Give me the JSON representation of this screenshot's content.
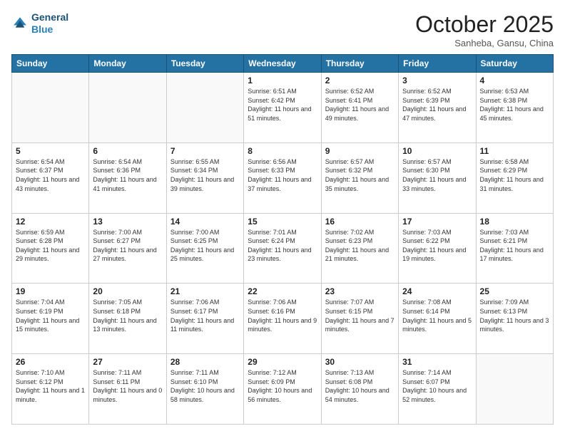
{
  "header": {
    "logo_line1": "General",
    "logo_line2": "Blue",
    "month_title": "October 2025",
    "location": "Sanheba, Gansu, China"
  },
  "weekdays": [
    "Sunday",
    "Monday",
    "Tuesday",
    "Wednesday",
    "Thursday",
    "Friday",
    "Saturday"
  ],
  "weeks": [
    [
      {
        "day": "",
        "sunrise": "",
        "sunset": "",
        "daylight": ""
      },
      {
        "day": "",
        "sunrise": "",
        "sunset": "",
        "daylight": ""
      },
      {
        "day": "",
        "sunrise": "",
        "sunset": "",
        "daylight": ""
      },
      {
        "day": "1",
        "sunrise": "Sunrise: 6:51 AM",
        "sunset": "Sunset: 6:42 PM",
        "daylight": "Daylight: 11 hours and 51 minutes."
      },
      {
        "day": "2",
        "sunrise": "Sunrise: 6:52 AM",
        "sunset": "Sunset: 6:41 PM",
        "daylight": "Daylight: 11 hours and 49 minutes."
      },
      {
        "day": "3",
        "sunrise": "Sunrise: 6:52 AM",
        "sunset": "Sunset: 6:39 PM",
        "daylight": "Daylight: 11 hours and 47 minutes."
      },
      {
        "day": "4",
        "sunrise": "Sunrise: 6:53 AM",
        "sunset": "Sunset: 6:38 PM",
        "daylight": "Daylight: 11 hours and 45 minutes."
      }
    ],
    [
      {
        "day": "5",
        "sunrise": "Sunrise: 6:54 AM",
        "sunset": "Sunset: 6:37 PM",
        "daylight": "Daylight: 11 hours and 43 minutes."
      },
      {
        "day": "6",
        "sunrise": "Sunrise: 6:54 AM",
        "sunset": "Sunset: 6:36 PM",
        "daylight": "Daylight: 11 hours and 41 minutes."
      },
      {
        "day": "7",
        "sunrise": "Sunrise: 6:55 AM",
        "sunset": "Sunset: 6:34 PM",
        "daylight": "Daylight: 11 hours and 39 minutes."
      },
      {
        "day": "8",
        "sunrise": "Sunrise: 6:56 AM",
        "sunset": "Sunset: 6:33 PM",
        "daylight": "Daylight: 11 hours and 37 minutes."
      },
      {
        "day": "9",
        "sunrise": "Sunrise: 6:57 AM",
        "sunset": "Sunset: 6:32 PM",
        "daylight": "Daylight: 11 hours and 35 minutes."
      },
      {
        "day": "10",
        "sunrise": "Sunrise: 6:57 AM",
        "sunset": "Sunset: 6:30 PM",
        "daylight": "Daylight: 11 hours and 33 minutes."
      },
      {
        "day": "11",
        "sunrise": "Sunrise: 6:58 AM",
        "sunset": "Sunset: 6:29 PM",
        "daylight": "Daylight: 11 hours and 31 minutes."
      }
    ],
    [
      {
        "day": "12",
        "sunrise": "Sunrise: 6:59 AM",
        "sunset": "Sunset: 6:28 PM",
        "daylight": "Daylight: 11 hours and 29 minutes."
      },
      {
        "day": "13",
        "sunrise": "Sunrise: 7:00 AM",
        "sunset": "Sunset: 6:27 PM",
        "daylight": "Daylight: 11 hours and 27 minutes."
      },
      {
        "day": "14",
        "sunrise": "Sunrise: 7:00 AM",
        "sunset": "Sunset: 6:25 PM",
        "daylight": "Daylight: 11 hours and 25 minutes."
      },
      {
        "day": "15",
        "sunrise": "Sunrise: 7:01 AM",
        "sunset": "Sunset: 6:24 PM",
        "daylight": "Daylight: 11 hours and 23 minutes."
      },
      {
        "day": "16",
        "sunrise": "Sunrise: 7:02 AM",
        "sunset": "Sunset: 6:23 PM",
        "daylight": "Daylight: 11 hours and 21 minutes."
      },
      {
        "day": "17",
        "sunrise": "Sunrise: 7:03 AM",
        "sunset": "Sunset: 6:22 PM",
        "daylight": "Daylight: 11 hours and 19 minutes."
      },
      {
        "day": "18",
        "sunrise": "Sunrise: 7:03 AM",
        "sunset": "Sunset: 6:21 PM",
        "daylight": "Daylight: 11 hours and 17 minutes."
      }
    ],
    [
      {
        "day": "19",
        "sunrise": "Sunrise: 7:04 AM",
        "sunset": "Sunset: 6:19 PM",
        "daylight": "Daylight: 11 hours and 15 minutes."
      },
      {
        "day": "20",
        "sunrise": "Sunrise: 7:05 AM",
        "sunset": "Sunset: 6:18 PM",
        "daylight": "Daylight: 11 hours and 13 minutes."
      },
      {
        "day": "21",
        "sunrise": "Sunrise: 7:06 AM",
        "sunset": "Sunset: 6:17 PM",
        "daylight": "Daylight: 11 hours and 11 minutes."
      },
      {
        "day": "22",
        "sunrise": "Sunrise: 7:06 AM",
        "sunset": "Sunset: 6:16 PM",
        "daylight": "Daylight: 11 hours and 9 minutes."
      },
      {
        "day": "23",
        "sunrise": "Sunrise: 7:07 AM",
        "sunset": "Sunset: 6:15 PM",
        "daylight": "Daylight: 11 hours and 7 minutes."
      },
      {
        "day": "24",
        "sunrise": "Sunrise: 7:08 AM",
        "sunset": "Sunset: 6:14 PM",
        "daylight": "Daylight: 11 hours and 5 minutes."
      },
      {
        "day": "25",
        "sunrise": "Sunrise: 7:09 AM",
        "sunset": "Sunset: 6:13 PM",
        "daylight": "Daylight: 11 hours and 3 minutes."
      }
    ],
    [
      {
        "day": "26",
        "sunrise": "Sunrise: 7:10 AM",
        "sunset": "Sunset: 6:12 PM",
        "daylight": "Daylight: 11 hours and 1 minute."
      },
      {
        "day": "27",
        "sunrise": "Sunrise: 7:11 AM",
        "sunset": "Sunset: 6:11 PM",
        "daylight": "Daylight: 11 hours and 0 minutes."
      },
      {
        "day": "28",
        "sunrise": "Sunrise: 7:11 AM",
        "sunset": "Sunset: 6:10 PM",
        "daylight": "Daylight: 10 hours and 58 minutes."
      },
      {
        "day": "29",
        "sunrise": "Sunrise: 7:12 AM",
        "sunset": "Sunset: 6:09 PM",
        "daylight": "Daylight: 10 hours and 56 minutes."
      },
      {
        "day": "30",
        "sunrise": "Sunrise: 7:13 AM",
        "sunset": "Sunset: 6:08 PM",
        "daylight": "Daylight: 10 hours and 54 minutes."
      },
      {
        "day": "31",
        "sunrise": "Sunrise: 7:14 AM",
        "sunset": "Sunset: 6:07 PM",
        "daylight": "Daylight: 10 hours and 52 minutes."
      },
      {
        "day": "",
        "sunrise": "",
        "sunset": "",
        "daylight": ""
      }
    ]
  ]
}
